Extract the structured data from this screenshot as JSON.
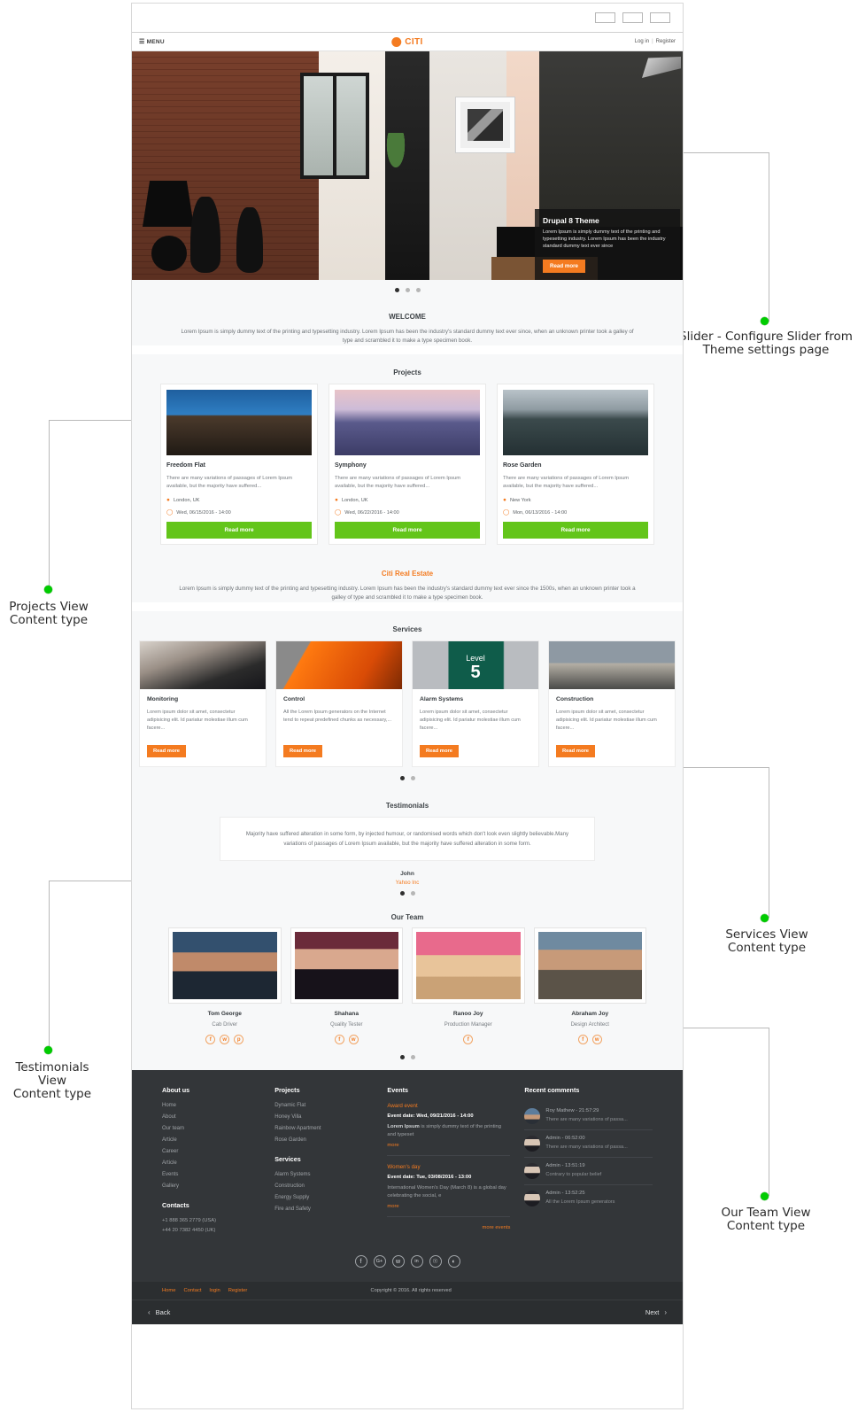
{
  "annotations": [
    {
      "id": "slider",
      "text": "Slider - Configure Slider from\nTheme settings page"
    },
    {
      "id": "projects",
      "text": "Projects View\nContent type"
    },
    {
      "id": "services",
      "text": "Services View\nContent type"
    },
    {
      "id": "testimonials",
      "text": "Testimonials View\nContent type"
    },
    {
      "id": "team",
      "text": "Our Team View\nContent type"
    }
  ],
  "annotation_labels": {
    "slider_l1": "Slider - Configure Slider from",
    "slider_l2": "Theme settings page",
    "projects_l1": "Projects View",
    "projects_l2": "Content type",
    "services_l1": "Services View",
    "services_l2": "Content type",
    "testimonials_l1": "Testimonials View",
    "testimonials_l2": "Content type",
    "team_l1": "Our Team View",
    "team_l2": "Content type"
  },
  "header": {
    "menu_label": "MENU",
    "brand": "CITI",
    "login": "Log in",
    "separator": "|",
    "register": "Register"
  },
  "slider": {
    "caption_title": "Drupal 8 Theme",
    "caption_body": "Lorem Ipsum is simply dummy text of the printing and typesetting industry. Lorem Ipsum has been the industry standard dummy text ever since",
    "read_more": "Read more",
    "active_dot": 0,
    "dot_count": 3
  },
  "welcome": {
    "title": "WELCOME",
    "body": "Lorem Ipsum is simply dummy text of the printing and typesetting industry. Lorem Ipsum has been the industry's standard dummy text ever since, when an unknown printer took a galley of type and scrambled it to make a type specimen book."
  },
  "projects": {
    "heading": "Projects",
    "read_more": "Read more",
    "items": [
      {
        "title": "Freedom Flat",
        "desc": "There are many variations of passages of Lorem Ipsum available, but the majority have suffered...",
        "location": "London, UK",
        "date": "Wed, 06/15/2016 - 14:00"
      },
      {
        "title": "Symphony",
        "desc": "There are many variations of passages of Lorem Ipsum available, but the majority have suffered...",
        "location": "London, UK",
        "date": "Wed, 06/22/2016 - 14:00"
      },
      {
        "title": "Rose Garden",
        "desc": "There are many variations of passages of Lorem Ipsum available, but the majority have suffered...",
        "location": "New York",
        "date": "Mon, 06/13/2016 - 14:00"
      }
    ]
  },
  "about_block": {
    "title": "Citi Real Estate",
    "body": "Lorem Ipsum is simply dummy text of the printing and typesetting industry. Lorem Ipsum has been the industry's standard dummy text ever since the 1500s, when an unknown printer took a galley of type and scrambled it to make a type specimen book."
  },
  "services": {
    "heading": "Services",
    "read_more": "Read more",
    "active_dot": 0,
    "dot_count": 2,
    "items": [
      {
        "title": "Monitoring",
        "desc": "Lorem ipsum dolor sit amet, consectetur adipisicing elit. Id pariatur molestiae illum cum facere..."
      },
      {
        "title": "Control",
        "desc": "All the Lorem Ipsum generators on the Internet tend to repeat predefined chunks as necessary,..."
      },
      {
        "title": "Alarm Systems",
        "desc": "Lorem ipsum dolor sit amet, consectetur adipisicing elit. Id pariatur molestiae illum cum facere..."
      },
      {
        "title": "Construction",
        "desc": "Lorem ipsum dolor sit amet, consectetur adipisicing elit. Id pariatur molestiae illum cum facere..."
      }
    ],
    "alarm_sign_word": "Level",
    "alarm_sign_num": "5"
  },
  "testimonials": {
    "heading": "Testimonials",
    "quote": "Majority have suffered alteration in some form, by injected humour, or randomised words which don't look even slightly believable.Many variations of passages of Lorem Ipsum available, but the majority have suffered alteration in some form.",
    "name": "John",
    "org": "Yahoo Inc",
    "active_dot": 0,
    "dot_count": 2
  },
  "team": {
    "heading": "Our Team",
    "active_dot": 0,
    "dot_count": 2,
    "members": [
      {
        "name": "Tom George",
        "role": "Cab Driver",
        "socials": [
          "f",
          "t",
          "p"
        ]
      },
      {
        "name": "Shahana",
        "role": "Quality Tester",
        "socials": [
          "f",
          "t"
        ]
      },
      {
        "name": "Ranoo Joy",
        "role": "Production Manager",
        "socials": [
          "f"
        ]
      },
      {
        "name": "Abraham Joy",
        "role": "Design Architect",
        "socials": [
          "f",
          "t"
        ]
      }
    ]
  },
  "footer": {
    "about": {
      "heading": "About us",
      "links": [
        "Home",
        "About",
        "Our team",
        "Article",
        "Career",
        "Article",
        "Events",
        "Gallery"
      ]
    },
    "contacts": {
      "heading": "Contacts",
      "phones": [
        "+1 888 365 2779 (USA)",
        "+44 20 7382 4450 (UK)"
      ]
    },
    "projects": {
      "heading": "Projects",
      "links": [
        "Dynamic Flat",
        "Honey Villa",
        "Rainbow Apartment",
        "Rose Garden"
      ]
    },
    "services": {
      "heading": "Services",
      "links": [
        "Alarm Systems",
        "Construction",
        "Energy Supply",
        "Fire and Safety"
      ]
    },
    "events": {
      "heading": "Events",
      "more_events": "more events",
      "items": [
        {
          "title": "Award event",
          "date": "Event date: Wed, 09/21/2016 - 14:00",
          "body_strong": "Lorem Ipsum",
          "body": " is simply dummy text of the printing and typeset",
          "more": "more"
        },
        {
          "title": "Women's day",
          "date": "Event date: Tue, 03/08/2016 - 13:00",
          "body_strong": "",
          "body": "International Women's Day (March 8) is a global day celebrating the social, e",
          "more": "more"
        }
      ]
    },
    "comments": {
      "heading": "Recent comments",
      "items": [
        {
          "author": "Roy Mathew - 21:57:29",
          "text": "There are many variations of passa..."
        },
        {
          "author": "Admin - 06:52:00",
          "text": "There are many variations of passa..."
        },
        {
          "author": "Admin - 13:51:19",
          "text": "Contrary to popular belief"
        },
        {
          "author": "Admin - 13:52:25",
          "text": "All the Lorem Ipsum generators"
        }
      ]
    },
    "socials": [
      "f",
      "G+",
      "t",
      "in",
      "@",
      "N"
    ],
    "bottom_links": [
      "Home",
      "Contact",
      "login",
      "Register"
    ],
    "copyright": "Copyright © 2016. All rights reserved"
  },
  "pager": {
    "back": "Back",
    "next": "Next",
    "back_chevron": "‹",
    "next_chevron": "›"
  }
}
